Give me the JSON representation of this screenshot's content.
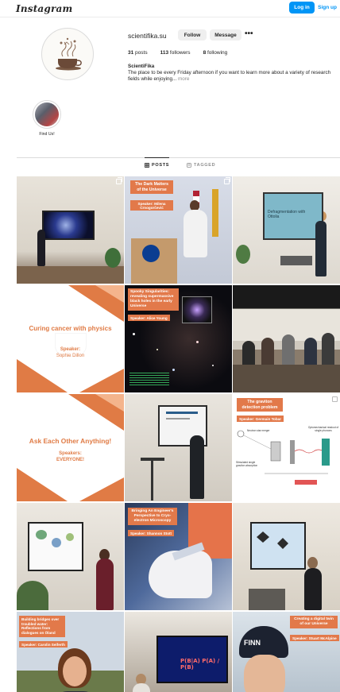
{
  "header": {
    "logo_text": "Instagram",
    "login_label": "Log in",
    "signup_label": "Sign up"
  },
  "profile": {
    "username": "scientifika.su",
    "follow_label": "Follow",
    "message_label": "Message",
    "more_label": "•••",
    "posts_count": "31",
    "posts_label": "posts",
    "followers_count": "113",
    "followers_label": "followers",
    "following_count": "8",
    "following_label": "following",
    "display_name": "ScientiFika",
    "bio_text": "The place to be every Friday afternoon if you want to learn more about a variety of research fields while enjoying...",
    "bio_more": "more"
  },
  "highlights": [
    {
      "label": "Find Us!"
    }
  ],
  "tabs": {
    "posts_label": "POSTS",
    "tagged_label": "TAGGED"
  },
  "posts": {
    "p2": {
      "title": "The Dark Matters of the Universe",
      "speaker": "Speaker: Milena Crnogorčević"
    },
    "p3": {
      "screen_text": "Defragmentation with Ottolia"
    },
    "p4": {
      "title": "Curing cancer with physics",
      "speaker_label": "Speaker:",
      "speaker_name": "Sophie Dillon"
    },
    "p5": {
      "title": "Spooky Singularities: revealing supermassive black holes in the early Universe",
      "speaker": "Speaker: Alice Young"
    },
    "p7": {
      "title": "Ask Each Other Anything!",
      "speaker_label": "Speakers:",
      "speaker_name": "EVERYONE!"
    },
    "p9": {
      "title": "The graviton detection problem",
      "speaker": "Speaker: Germain Tobar",
      "diagram_labels": [
        "Neutron star merger",
        "Stimulated single graviton absorption",
        "Optomechanical readout of single phonons"
      ]
    },
    "p11": {
      "title": "Bringing An Engineer's Perspective to Cryo-electron Microscopy",
      "speaker": "Speaker: Shannon Stott"
    },
    "p13": {
      "title": "Building bridges over troubled water: Reflections from dialogues on Öland",
      "speaker": "Speaker: Carolin Seiferth"
    },
    "p14": {
      "screen_text": "P(B|A) P(A) / P(B)"
    },
    "p15": {
      "title": "Creating a digital twin of our Universe",
      "speaker": "Speaker: Stuart McAlpine",
      "hat_text": "FINN"
    }
  },
  "colors": {
    "accent_orange": "#e2794a",
    "link_blue": "#0095f6"
  }
}
